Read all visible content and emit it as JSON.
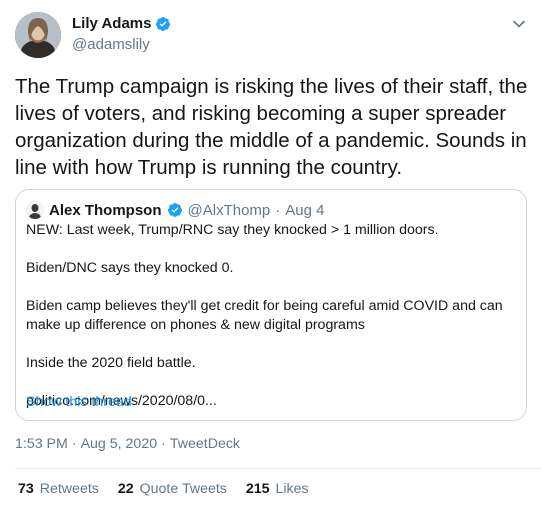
{
  "author": {
    "name": "Lily Adams",
    "handle": "@adamslily",
    "verified": true
  },
  "tweet": {
    "text": "The Trump campaign is risking the lives of their staff, the lives of voters, and risking becoming a super spreader organization during the middle of a pandemic. Sounds in line with how Trump is running the country."
  },
  "quoted_tweet": {
    "name": "Alex Thompson",
    "handle": "@AlxThomp",
    "separator": "·",
    "date": "Aug 4",
    "paragraphs": [
      "NEW: Last week, Trump/RNC say they knocked > 1 million doors.",
      "Biden/DNC says they knocked 0.",
      "Biden camp believes they'll get credit for being careful amid COVID and can make up difference on phones & new digital programs",
      "Inside the 2020 field battle.",
      "politico.com/news/2020/08/0..."
    ],
    "show_thread": "Show this thread"
  },
  "meta": {
    "time": "1:53 PM",
    "sep1": "·",
    "date": "Aug 5, 2020",
    "sep2": "·",
    "source": "TweetDeck"
  },
  "stats": {
    "retweets_count": "73",
    "retweets_label": "Retweets",
    "quotes_count": "22",
    "quotes_label": "Quote Tweets",
    "likes_count": "215",
    "likes_label": "Likes"
  },
  "colors": {
    "accent": "#1b95e0",
    "secondary_text": "#657786",
    "border": "#ccd6dd"
  },
  "icons": {
    "verified": "verified-badge-icon",
    "menu": "chevron-down-icon"
  }
}
